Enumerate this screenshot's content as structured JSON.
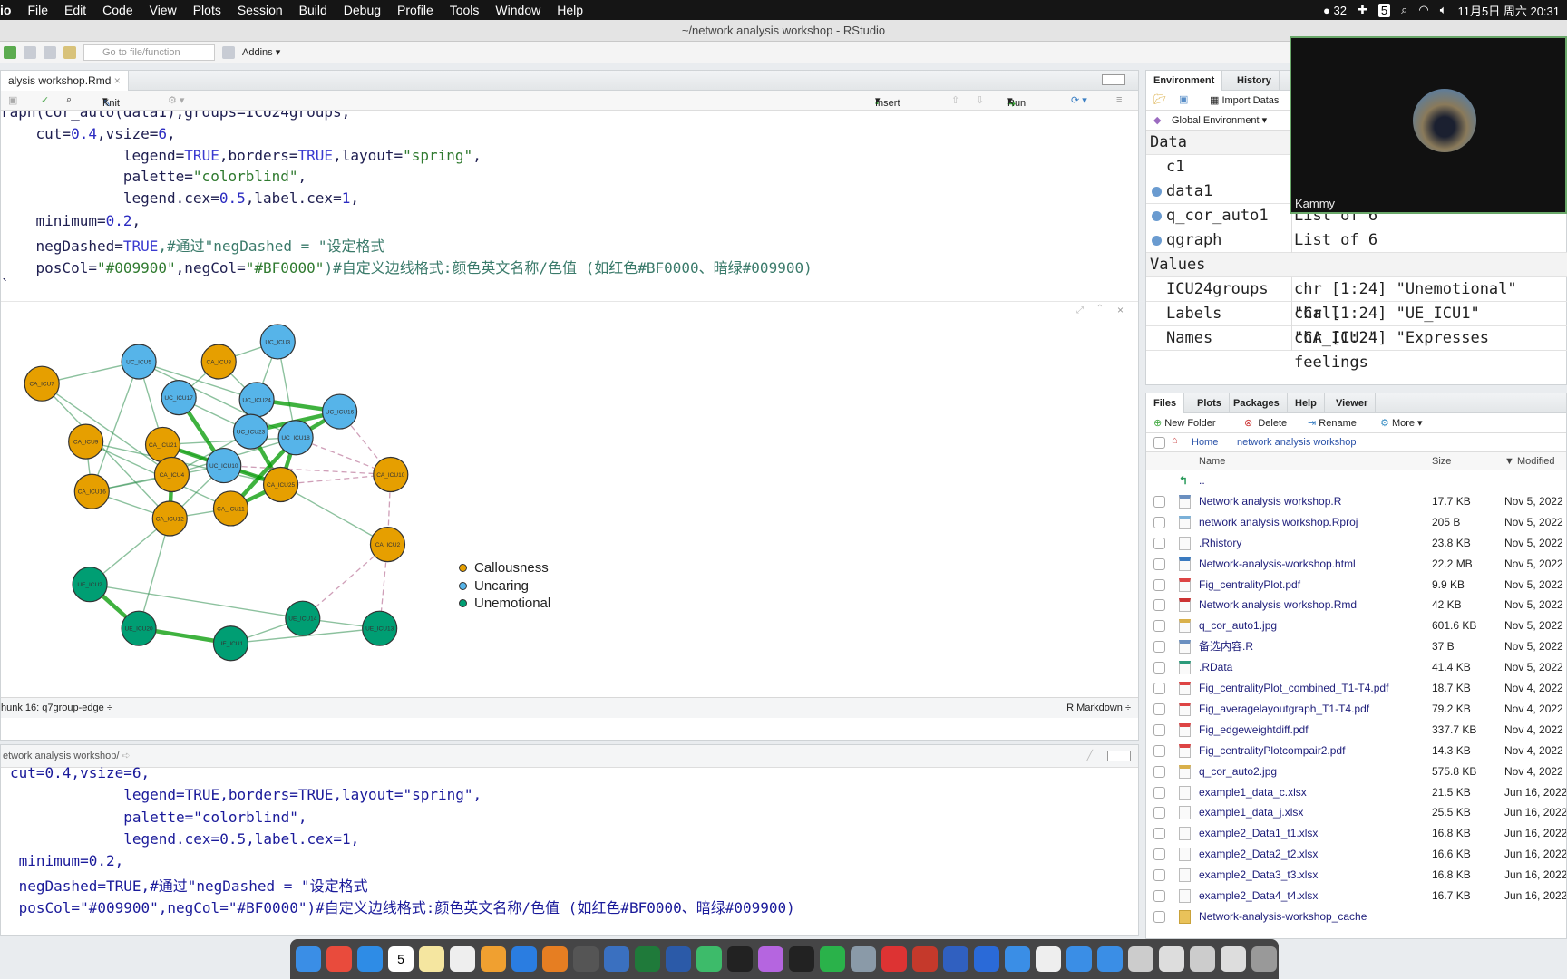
{
  "menubar": {
    "app": "io",
    "items": [
      "File",
      "Edit",
      "Code",
      "View",
      "Plots",
      "Session",
      "Build",
      "Debug",
      "Profile",
      "Tools",
      "Window",
      "Help"
    ],
    "status": {
      "wechat_count": "32",
      "badge": "5",
      "datetime": "11月5日 周六  20:31"
    }
  },
  "window_title": "~/network analysis workshop - RStudio",
  "toolbar": {
    "goto_placeholder": "Go to file/function",
    "addins": "Addins"
  },
  "editor": {
    "tab": "alysis workshop.Rmd",
    "knit": "Knit",
    "insert": "Insert",
    "run": "Run",
    "lines": [
      [
        {
          "t": "raph(cor_auto(data1),groups=ICU24groups,",
          "k": ""
        }
      ],
      [
        {
          "t": "    cut=",
          "k": ""
        },
        {
          "t": "0.4",
          "k": "num"
        },
        {
          "t": ",vsize=",
          "k": ""
        },
        {
          "t": "6",
          "k": "num"
        },
        {
          "t": ",",
          "k": ""
        }
      ],
      [
        {
          "t": "              legend=",
          "k": ""
        },
        {
          "t": "TRUE",
          "k": "kw"
        },
        {
          "t": ",borders=",
          "k": ""
        },
        {
          "t": "TRUE",
          "k": "kw"
        },
        {
          "t": ",layout=",
          "k": ""
        },
        {
          "t": "\"spring\"",
          "k": "str"
        },
        {
          "t": ",",
          "k": ""
        }
      ],
      [
        {
          "t": "              palette=",
          "k": ""
        },
        {
          "t": "\"colorblind\"",
          "k": "str"
        },
        {
          "t": ",",
          "k": ""
        }
      ],
      [
        {
          "t": "              legend.cex=",
          "k": ""
        },
        {
          "t": "0.5",
          "k": "num"
        },
        {
          "t": ",label.cex=",
          "k": ""
        },
        {
          "t": "1",
          "k": "num"
        },
        {
          "t": ",",
          "k": ""
        }
      ],
      [
        {
          "t": "    minimum=",
          "k": ""
        },
        {
          "t": "0.2",
          "k": "num"
        },
        {
          "t": ",",
          "k": ""
        }
      ],
      [
        {
          "t": "    negDashed=",
          "k": ""
        },
        {
          "t": "TRUE",
          "k": "kw"
        },
        {
          "t": ",#通过\"negDashed = \"设定格式",
          "k": "com"
        }
      ],
      [
        {
          "t": "    posCol=",
          "k": ""
        },
        {
          "t": "\"#009900\"",
          "k": "str"
        },
        {
          "t": ",negCol=",
          "k": ""
        },
        {
          "t": "\"#BF0000\"",
          "k": "str"
        },
        {
          "t": ")#自定义边线格式:颜色英文名称/色值 (如红色#BF0000、暗绿#009900)",
          "k": "com"
        }
      ],
      [
        {
          "t": "`",
          "k": ""
        }
      ]
    ],
    "chunk": "hunk 16: q7group-edge ÷",
    "mode": "R Markdown ÷"
  },
  "plot": {
    "legend": [
      {
        "label": "Callousness",
        "color": "#E69F00"
      },
      {
        "label": "Uncaring",
        "color": "#56B4E9"
      },
      {
        "label": "Unemotional",
        "color": "#009E73"
      }
    ],
    "nodes": [
      [
        "CA_ICU7",
        0
      ],
      [
        "UC_ICU5",
        1
      ],
      [
        "CA_ICU8",
        0
      ],
      [
        "UC_ICU3",
        1
      ],
      [
        "UC_ICU17",
        1
      ],
      [
        "UC_ICU24",
        1
      ],
      [
        "UC_ICU16",
        1
      ],
      [
        "CA_ICU9",
        0
      ],
      [
        "CA_ICU21",
        0
      ],
      [
        "UC_ICU23",
        1
      ],
      [
        "UC_ICU18",
        1
      ],
      [
        "UC_ICU10",
        1
      ],
      [
        "CA_ICU4",
        0
      ],
      [
        "CA_ICU25",
        0
      ],
      [
        "CA_ICU10",
        0
      ],
      [
        "CA_ICU16",
        0
      ],
      [
        "CA_ICU11",
        0
      ],
      [
        "CA_ICU12",
        0
      ],
      [
        "CA_ICU2",
        0
      ],
      [
        "UE_ICU2",
        2
      ],
      [
        "UE_ICU20",
        2
      ],
      [
        "UE_ICU1",
        2
      ],
      [
        "UE_ICU14",
        2
      ],
      [
        "UE_ICU13",
        2
      ]
    ],
    "positive_color": "#009900",
    "negative_color": "#BF0000",
    "edges_strong": [
      [
        5,
        6
      ],
      [
        9,
        6
      ],
      [
        10,
        6
      ],
      [
        11,
        8
      ],
      [
        11,
        13
      ],
      [
        12,
        17
      ],
      [
        9,
        13
      ],
      [
        16,
        13
      ],
      [
        4,
        11
      ],
      [
        10,
        13
      ],
      [
        19,
        20
      ],
      [
        20,
        21
      ],
      [
        10,
        16
      ],
      [
        5,
        9
      ]
    ],
    "edges_medium": [
      [
        1,
        5
      ],
      [
        0,
        12
      ],
      [
        0,
        17
      ],
      [
        1,
        12
      ],
      [
        2,
        4
      ],
      [
        2,
        5
      ],
      [
        3,
        5
      ],
      [
        3,
        10
      ],
      [
        7,
        13
      ],
      [
        7,
        16
      ],
      [
        15,
        12
      ],
      [
        15,
        11
      ],
      [
        15,
        17
      ],
      [
        17,
        16
      ],
      [
        8,
        10
      ],
      [
        4,
        9
      ],
      [
        12,
        9
      ],
      [
        17,
        11
      ],
      [
        12,
        10
      ],
      [
        13,
        18
      ],
      [
        17,
        20
      ],
      [
        17,
        19
      ],
      [
        21,
        22
      ],
      [
        22,
        23
      ],
      [
        21,
        23
      ],
      [
        19,
        22
      ],
      [
        1,
        10
      ],
      [
        8,
        13
      ],
      [
        7,
        15
      ],
      [
        1,
        15
      ],
      [
        0,
        1
      ],
      [
        2,
        3
      ]
    ],
    "edges_negative": [
      [
        6,
        14
      ],
      [
        10,
        14
      ],
      [
        13,
        14
      ],
      [
        14,
        18
      ],
      [
        18,
        22
      ],
      [
        18,
        23
      ],
      [
        11,
        14
      ]
    ]
  },
  "console": {
    "path": "etwork analysis workshop/",
    "lines": [
      "cut=0.4,vsize=6,",
      "             legend=TRUE,borders=TRUE,layout=\"spring\",",
      "             palette=\"colorblind\",",
      "             legend.cex=0.5,label.cex=1,",
      " minimum=0.2,",
      " negDashed=TRUE,#通过\"negDashed = \"设定格式",
      " posCol=\"#009900\",negCol=\"#BF0000\")#自定义边线格式:颜色英文名称/色值 (如红色#BF0000、暗绿#009900)"
    ]
  },
  "environment": {
    "tabs": [
      "Environment",
      "History"
    ],
    "import": "Import Datas",
    "scope": "Global Environment",
    "data_header": "Data",
    "values_header": "Values",
    "data": [
      {
        "name": "c1",
        "value": ""
      },
      {
        "name": "data1",
        "value": ""
      },
      {
        "name": "q_cor_auto1",
        "value": "List of 6"
      },
      {
        "name": "qgraph",
        "value": "List of 6"
      }
    ],
    "values": [
      {
        "name": "ICU24groups",
        "value": "chr [1:24] \"Unemotional\" \"Call"
      },
      {
        "name": "Labels",
        "value": "chr [1:24] \"UE_ICU1\" \"CA_ICU2\""
      },
      {
        "name": "Names",
        "value": "chr [1:24] \"Expresses feelings"
      }
    ]
  },
  "video": {
    "name": "Kammy"
  },
  "files": {
    "tabs": [
      "Files",
      "Plots",
      "Packages",
      "Help",
      "Viewer"
    ],
    "actions": [
      "New Folder",
      "Delete",
      "Rename",
      "More"
    ],
    "breadcrumb": [
      "Home",
      "network analysis workshop"
    ],
    "columns": [
      "Name",
      "Size",
      "Modified"
    ],
    "up": "..",
    "rows": [
      {
        "name": "Network analysis workshop.R",
        "size": "17.7 KB",
        "modified": "Nov 5, 2022"
      },
      {
        "name": "network analysis workshop.Rproj",
        "size": "205 B",
        "modified": "Nov 5, 2022"
      },
      {
        "name": ".Rhistory",
        "size": "23.8 KB",
        "modified": "Nov 5, 2022"
      },
      {
        "name": "Network-analysis-workshop.html",
        "size": "22.2 MB",
        "modified": "Nov 5, 2022"
      },
      {
        "name": "Fig_centralityPlot.pdf",
        "size": "9.9 KB",
        "modified": "Nov 5, 2022"
      },
      {
        "name": "Network analysis workshop.Rmd",
        "size": "42 KB",
        "modified": "Nov 5, 2022"
      },
      {
        "name": "q_cor_auto1.jpg",
        "size": "601.6 KB",
        "modified": "Nov 5, 2022"
      },
      {
        "name": "备选内容.R",
        "size": "37 B",
        "modified": "Nov 5, 2022"
      },
      {
        "name": ".RData",
        "size": "41.4 KB",
        "modified": "Nov 5, 2022"
      },
      {
        "name": "Fig_centralityPlot_combined_T1-T4.pdf",
        "size": "18.7 KB",
        "modified": "Nov 4, 2022"
      },
      {
        "name": "Fig_averagelayoutgraph_T1-T4.pdf",
        "size": "79.2 KB",
        "modified": "Nov 4, 2022"
      },
      {
        "name": "Fig_edgeweightdiff.pdf",
        "size": "337.7 KB",
        "modified": "Nov 4, 2022"
      },
      {
        "name": "Fig_centralityPlotcompair2.pdf",
        "size": "14.3 KB",
        "modified": "Nov 4, 2022"
      },
      {
        "name": "q_cor_auto2.jpg",
        "size": "575.8 KB",
        "modified": "Nov 4, 2022"
      },
      {
        "name": "example1_data_c.xlsx",
        "size": "21.5 KB",
        "modified": "Jun 16, 2022"
      },
      {
        "name": "example1_data_j.xlsx",
        "size": "25.5 KB",
        "modified": "Jun 16, 2022"
      },
      {
        "name": "example2_Data1_t1.xlsx",
        "size": "16.8 KB",
        "modified": "Jun 16, 2022"
      },
      {
        "name": "example2_Data2_t2.xlsx",
        "size": "16.6 KB",
        "modified": "Jun 16, 2022"
      },
      {
        "name": "example2_Data3_t3.xlsx",
        "size": "16.8 KB",
        "modified": "Jun 16, 2022"
      },
      {
        "name": "example2_Data4_t4.xlsx",
        "size": "16.7 KB",
        "modified": "Jun 16, 2022"
      },
      {
        "name": "Network-analysis-workshop_cache",
        "size": "",
        "modified": ""
      }
    ]
  },
  "dock": {
    "calendar_day": "5"
  }
}
